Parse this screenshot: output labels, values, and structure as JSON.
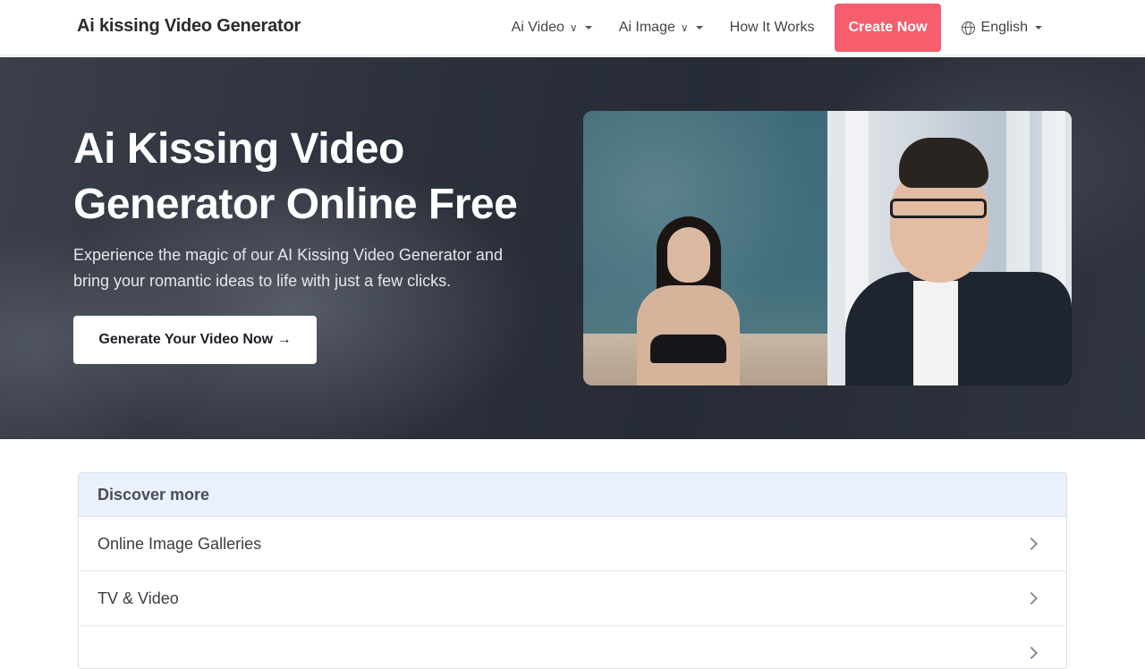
{
  "navbar": {
    "brand": "Ai kissing Video Generator",
    "items": [
      {
        "label": "Ai Video"
      },
      {
        "label": "Ai Image"
      },
      {
        "label": "How It Works"
      }
    ],
    "cta_label": "Create Now",
    "language_label": "English"
  },
  "hero": {
    "title": "Ai Kissing Video Generator Online Free",
    "subtitle": "Experience the magic of our AI Kissing Video Generator and bring your romantic ideas to life with just a few clicks.",
    "button_label": "Generate Your Video Now →"
  },
  "discover": {
    "title": "Discover more",
    "items": [
      {
        "label": "Online Image Galleries"
      },
      {
        "label": "TV & Video"
      }
    ]
  },
  "colors": {
    "accent": "#f65d6d",
    "discover_header_bg": "#eaf1fd"
  }
}
